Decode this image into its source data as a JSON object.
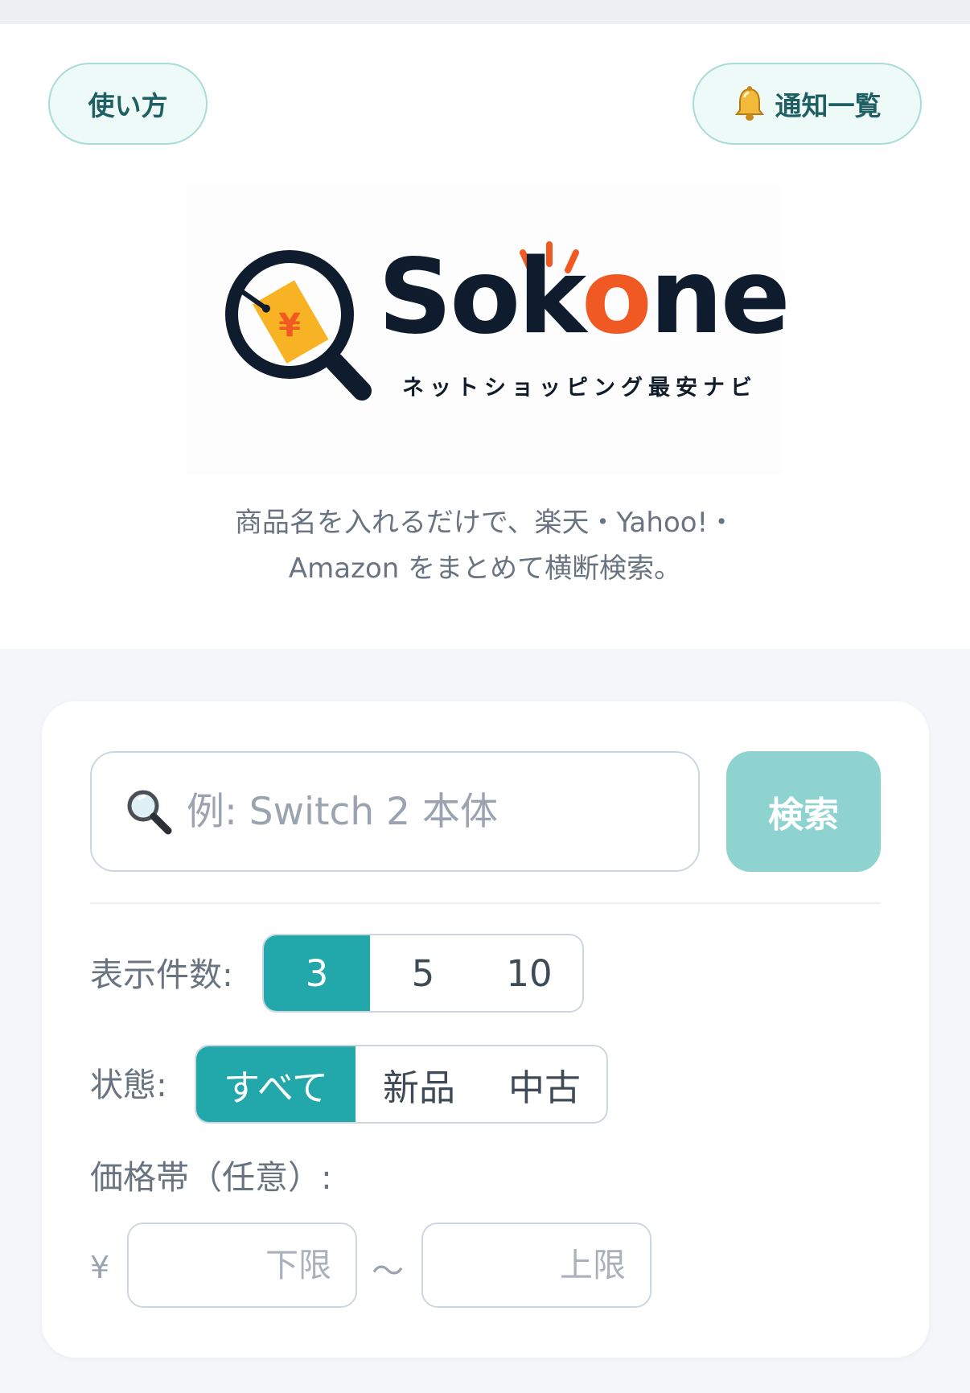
{
  "header": {
    "how_to_label": "使い方",
    "notifications_label": "通知一覧"
  },
  "logo": {
    "wordmark_prefix": "Sok",
    "wordmark_o": "o",
    "wordmark_suffix": "ne",
    "tagline": "ネットショッピング最安ナビ",
    "tag_symbol": "¥"
  },
  "description": {
    "line1": "商品名を入れるだけで、楽天・Yahoo!・",
    "line2": "Amazon をまとめて横断検索。"
  },
  "search": {
    "placeholder": "例: Switch 2 本体",
    "button_label": "検索"
  },
  "display_count": {
    "label": "表示件数:",
    "options": [
      "3",
      "5",
      "10"
    ],
    "selected": "3"
  },
  "condition": {
    "label": "状態:",
    "options": [
      "すべて",
      "新品",
      "中古"
    ],
    "selected": "すべて"
  },
  "price_range": {
    "label": "価格帯（任意）:",
    "currency": "¥",
    "min_placeholder": "下限",
    "separator": "〜",
    "max_placeholder": "上限"
  },
  "colors": {
    "accent": "#22a8ab",
    "search_button": "#8ed3cf",
    "logo_dark": "#0f1c2e",
    "logo_orange": "#f05a22",
    "tag_yellow": "#f7b324"
  },
  "icons": [
    "bell-icon",
    "search-icon",
    "magnifier-logo-icon",
    "price-tag-icon"
  ]
}
